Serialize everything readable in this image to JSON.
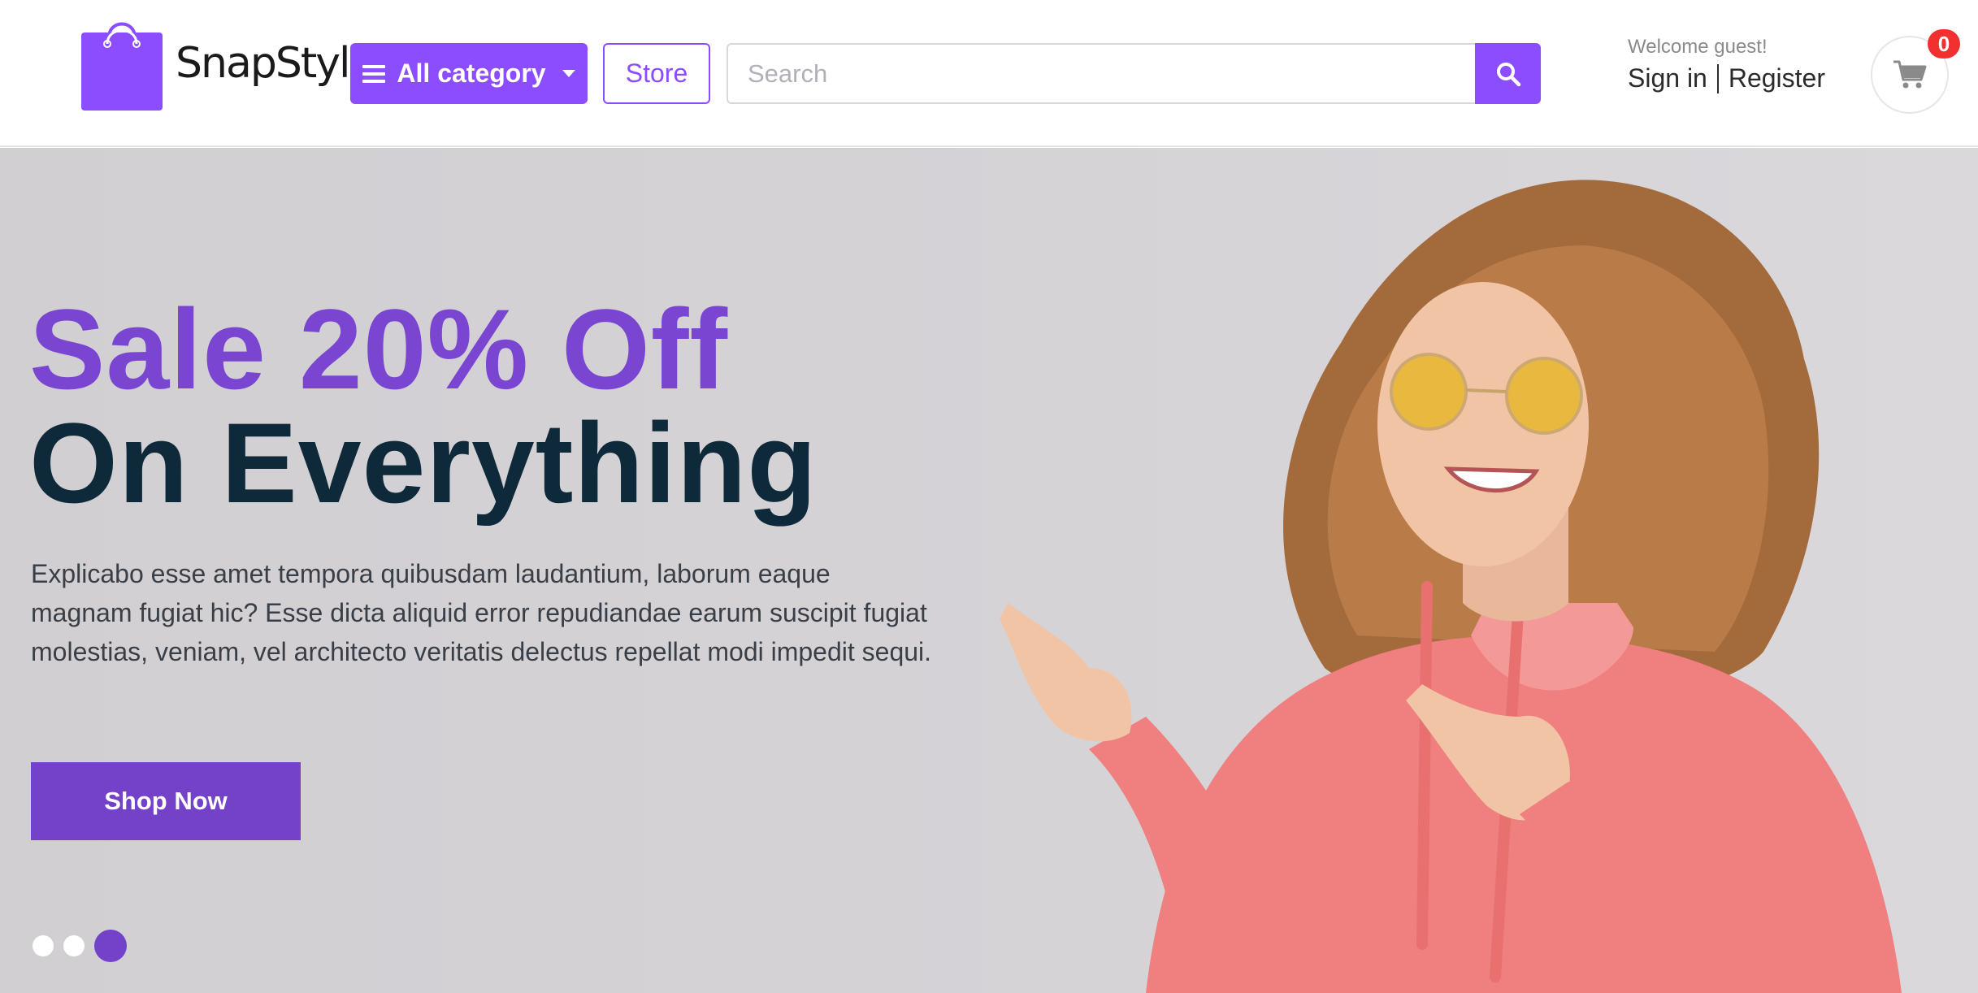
{
  "header": {
    "logo_text": "SnapStyle",
    "category_button": "All category",
    "store_button": "Store",
    "search_placeholder": "Search",
    "welcome": "Welcome guest!",
    "sign_in": "Sign in",
    "register": "Register",
    "cart_count": "0"
  },
  "hero": {
    "title_line1": "Sale 20% Off",
    "title_line2": "On Everything",
    "description": "Explicabo esse amet tempora quibusdam laudantium, laborum eaque magnam fugiat hic? Esse dicta aliquid error repudiandae earum suscipit fugiat molestias, veniam, vel architecto veritatis delectus repellat modi impedit sequi.",
    "cta": "Shop Now",
    "slides_total": 3,
    "active_slide": 3
  },
  "icons": {
    "logo": "shopping-bag-icon",
    "menu": "hamburger-icon",
    "caret": "caret-down-icon",
    "search": "search-icon",
    "cart": "cart-icon"
  },
  "colors": {
    "brand": "#8b4dff",
    "brand_dark": "#7441c9",
    "headline_dark": "#0e2a3a",
    "badge": "#f0312f"
  }
}
